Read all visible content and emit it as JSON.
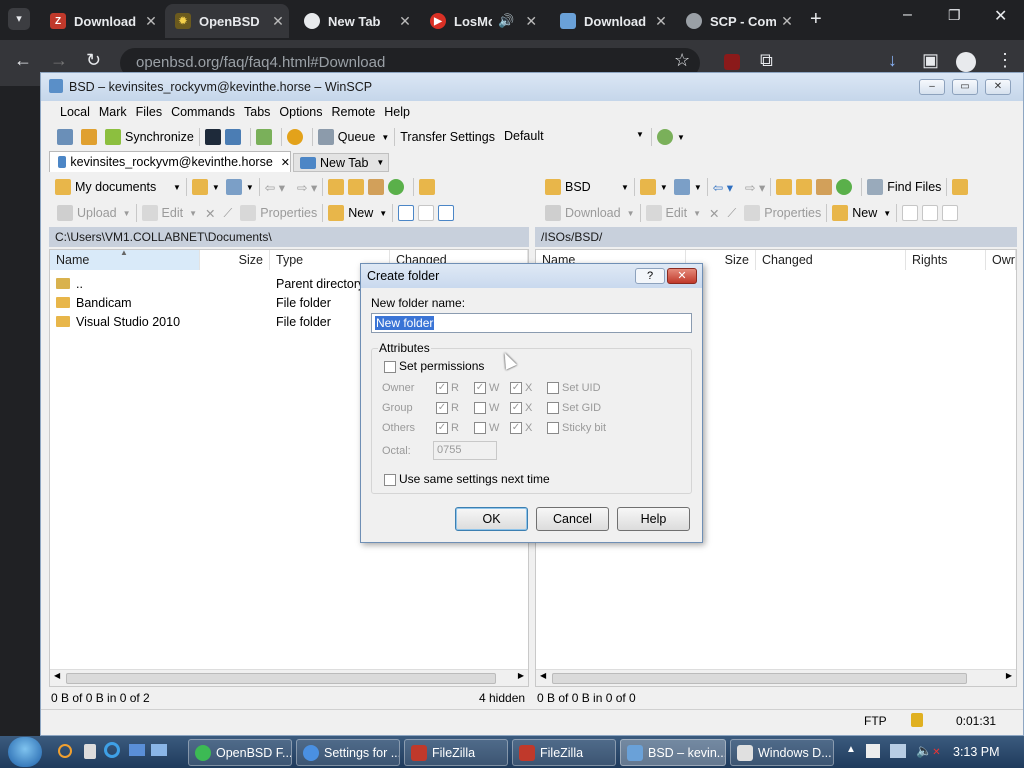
{
  "browser": {
    "tabs": [
      {
        "title": "Download",
        "icon": "filezilla-icon",
        "color": "#c0392b",
        "active": false
      },
      {
        "title": "OpenBSD",
        "icon": "openbsd-icon",
        "color": "#c9a227",
        "active": true
      },
      {
        "title": "New Tab",
        "icon": "chrome-icon",
        "color": "#e8eaed",
        "active": false
      },
      {
        "title": "LosMo",
        "icon": "youtube-icon",
        "color": "#d93025",
        "active": false
      },
      {
        "title": "Download",
        "icon": "winscp-icon",
        "color": "#6aa1d8",
        "active": false
      },
      {
        "title": "SCP - Com",
        "icon": "globe-icon",
        "color": "#9aa0a6",
        "active": false
      }
    ],
    "url": "openbsd.org/faq/faq4.html#Download"
  },
  "winscp": {
    "title": "BSD – kevinsites_rockyvm@kevinthe.horse – WinSCP",
    "menu": [
      "Local",
      "Mark",
      "Files",
      "Commands",
      "Tabs",
      "Options",
      "Remote",
      "Help"
    ],
    "toolbar": {
      "synchronize": "Synchronize",
      "queue": "Queue",
      "transfer_settings": "Transfer Settings",
      "transfer_value": "Default"
    },
    "tabs": {
      "session": "kevinsites_rockyvm@kevinthe.horse",
      "new_tab": "New Tab"
    },
    "left": {
      "location": "My documents",
      "actions": {
        "upload": "Upload",
        "edit": "Edit",
        "properties": "Properties",
        "new": "New"
      },
      "path": "C:\\Users\\VM1.COLLABNET\\Documents\\",
      "columns": {
        "name": "Name",
        "size": "Size",
        "type": "Type",
        "changed": "Changed"
      },
      "rows": [
        {
          "name": "..",
          "type": "Parent directory"
        },
        {
          "name": "Bandicam",
          "type": "File folder"
        },
        {
          "name": "Visual Studio 2010",
          "type": "File folder"
        }
      ],
      "status": "0 B of 0 B in 0 of 2",
      "hidden": "4 hidden"
    },
    "right": {
      "location": "BSD",
      "find_files": "Find Files",
      "actions": {
        "download": "Download",
        "edit": "Edit",
        "properties": "Properties",
        "new": "New"
      },
      "path": "/ISOs/BSD/",
      "columns": {
        "name": "Name",
        "size": "Size",
        "changed": "Changed",
        "rights": "Rights",
        "owner": "Owr"
      },
      "status": "0 B of 0 B in 0 of 0"
    },
    "statusbar": {
      "protocol": "FTP",
      "time": "0:01:31"
    }
  },
  "dialog": {
    "title": "Create folder",
    "help_glyph": "?",
    "name_label": "New folder name:",
    "name_value": "New folder",
    "attributes_label": "Attributes",
    "set_permissions": "Set permissions",
    "owner": "Owner",
    "group": "Group",
    "others": "Others",
    "r": "R",
    "w": "W",
    "x": "X",
    "set_uid": "Set UID",
    "set_gid": "Set GID",
    "sticky": "Sticky bit",
    "octal_label": "Octal:",
    "octal_value": "0755",
    "same_settings": "Use same settings next time",
    "ok": "OK",
    "cancel": "Cancel",
    "help": "Help"
  },
  "taskbar": {
    "items": [
      "OpenBSD F...",
      "Settings for ...",
      "FileZilla",
      "FileZilla",
      "BSD – kevin...",
      "Windows D..."
    ],
    "clock": "3:13 PM"
  }
}
